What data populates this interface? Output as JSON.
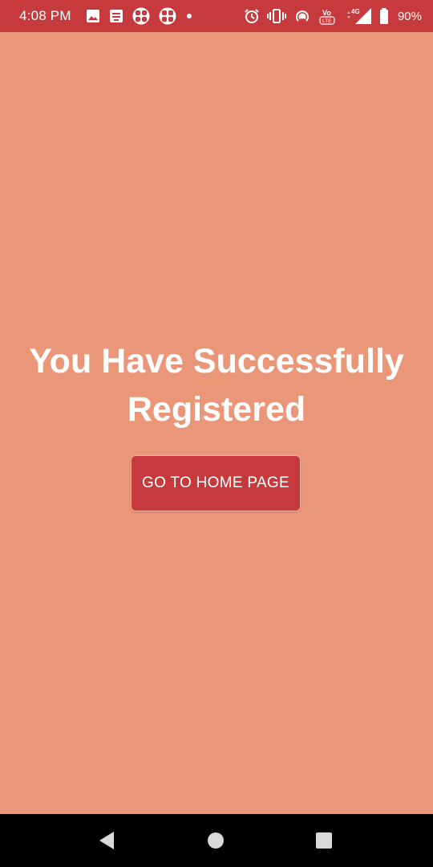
{
  "status_bar": {
    "time": "4:08 PM",
    "network": "4G",
    "volte": "VoLTE",
    "battery": "90%"
  },
  "screen": {
    "title": "You Have Successfully Registered",
    "button_label": "GO TO HOME PAGE"
  },
  "colors": {
    "background": "#E99679",
    "primary": "#C63A3D",
    "nav": "#000000"
  },
  "icons": {
    "status_left": [
      "image-icon",
      "message-icon",
      "app-icon",
      "app-icon",
      "dot-icon"
    ],
    "status_right": [
      "alarm-icon",
      "vibrate-icon",
      "hotspot-icon",
      "volte-icon",
      "signal-icon",
      "battery-icon"
    ],
    "nav": [
      "back-icon",
      "home-icon",
      "recents-icon"
    ]
  }
}
